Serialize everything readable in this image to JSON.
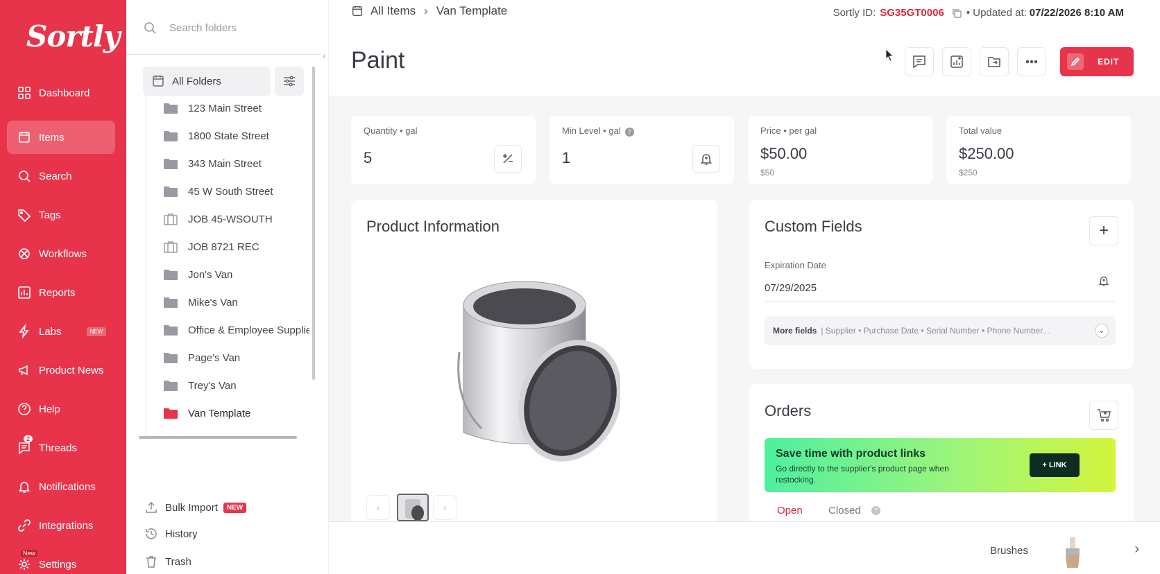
{
  "app": {
    "logo_text": "Sortly",
    "brand_color": "#e8344a"
  },
  "nav": {
    "items": [
      {
        "label": "Dashboard",
        "icon": "dashboard-icon"
      },
      {
        "label": "Items",
        "icon": "items-icon",
        "active": true
      },
      {
        "label": "Search",
        "icon": "search-icon"
      },
      {
        "label": "Tags",
        "icon": "tag-icon"
      },
      {
        "label": "Workflows",
        "icon": "workflow-icon"
      },
      {
        "label": "Reports",
        "icon": "reports-icon"
      },
      {
        "label": "Labs",
        "icon": "labs-icon",
        "badge": "NEW"
      },
      {
        "label": "Product News",
        "icon": "megaphone-icon"
      },
      {
        "label": "Help",
        "icon": "help-icon"
      },
      {
        "label": "Threads",
        "icon": "threads-icon",
        "count": "2"
      },
      {
        "label": "Notifications",
        "icon": "bell-icon"
      },
      {
        "label": "Integrations",
        "icon": "integrations-icon"
      },
      {
        "label": "Settings",
        "icon": "gear-icon",
        "badge": "New"
      }
    ]
  },
  "folders": {
    "search_placeholder": "Search folders",
    "all_label": "All Folders",
    "list": [
      {
        "name": "123 Main Street",
        "type": "folder"
      },
      {
        "name": "1800 State Street",
        "type": "folder"
      },
      {
        "name": "343 Main Street",
        "type": "folder"
      },
      {
        "name": "45 W South Street",
        "type": "folder"
      },
      {
        "name": "JOB 45-WSOUTH",
        "type": "job"
      },
      {
        "name": "JOB 8721 REC",
        "type": "job"
      },
      {
        "name": "Jon's Van",
        "type": "folder"
      },
      {
        "name": "Mike's Van",
        "type": "folder"
      },
      {
        "name": "Office & Employee Supplies",
        "type": "folder"
      },
      {
        "name": "Page's Van",
        "type": "folder"
      },
      {
        "name": "Trey's Van",
        "type": "folder"
      },
      {
        "name": "Van Template",
        "type": "folder",
        "selected": true
      }
    ],
    "bulk_import": "Bulk Import",
    "bulk_badge": "NEW",
    "history": "History",
    "trash": "Trash"
  },
  "header": {
    "breadcrumb": [
      "All Items",
      "Van Template"
    ],
    "sortly_id_label": "Sortly ID:",
    "sortly_id": "SG35GT0006",
    "updated_label": "• Updated at:",
    "updated_at": "07/22/2026 8:10 AM",
    "title": "Paint",
    "edit_label": "EDIT"
  },
  "stats": [
    {
      "label": "Quantity",
      "unit": "gal",
      "value": "5"
    },
    {
      "label": "Min Level",
      "unit": "gal",
      "value": "1"
    },
    {
      "label": "Price",
      "unit": "per gal",
      "value": "$50.00",
      "sub": "$50"
    },
    {
      "label": "Total value",
      "value": "$250.00",
      "sub": "$250"
    }
  ],
  "product": {
    "title": "Product Information"
  },
  "custom_fields": {
    "title": "Custom Fields",
    "field_label": "Expiration Date",
    "field_value": "07/29/2025",
    "more_label": "More fields",
    "more_list": "| Supplier • Purchase Date • Serial Number • Phone Number..."
  },
  "orders": {
    "title": "Orders",
    "promo_title": "Save time with product links",
    "promo_body": "Go directly to the supplier's product page when restocking.",
    "promo_button": "+ LINK",
    "tab_open": "Open",
    "tab_closed": "Closed"
  },
  "footer": {
    "next_item": "Brushes"
  }
}
